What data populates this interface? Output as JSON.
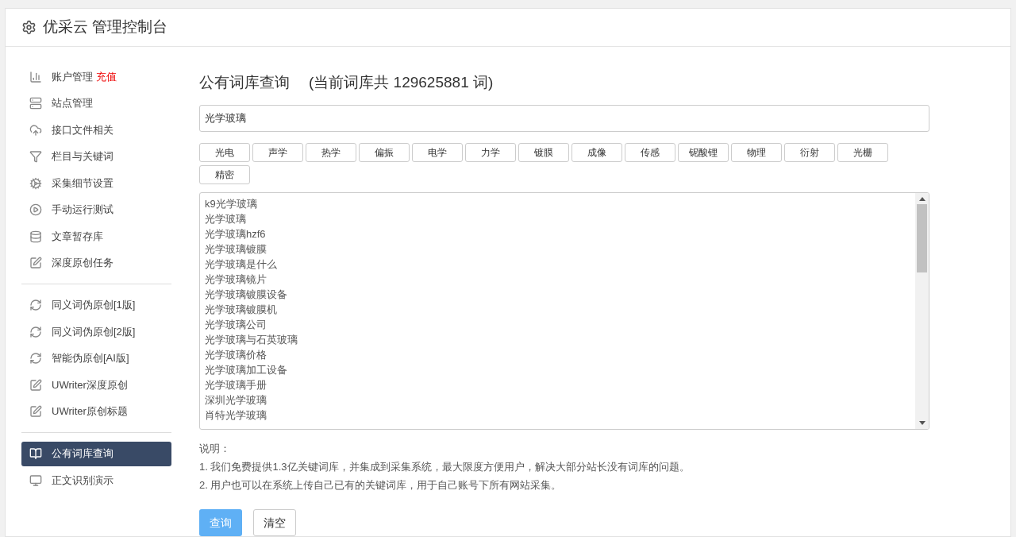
{
  "header": {
    "title": "优采云 管理控制台"
  },
  "sidebar": {
    "groups": [
      [
        {
          "label": "账户管理",
          "badge": "充值",
          "selected": false
        },
        {
          "label": "站点管理",
          "selected": false
        },
        {
          "label": "接口文件相关",
          "selected": false
        },
        {
          "label": "栏目与关键词",
          "selected": false
        },
        {
          "label": "采集细节设置",
          "selected": false
        },
        {
          "label": "手动运行测试",
          "selected": false
        },
        {
          "label": "文章暂存库",
          "selected": false
        },
        {
          "label": "深度原创任务",
          "selected": false
        }
      ],
      [
        {
          "label": "同义词伪原创[1版]",
          "selected": false
        },
        {
          "label": "同义词伪原创[2版]",
          "selected": false
        },
        {
          "label": "智能伪原创[AI版]",
          "selected": false
        },
        {
          "label": "UWriter深度原创",
          "selected": false
        },
        {
          "label": "UWriter原创标题",
          "selected": false
        }
      ],
      [
        {
          "label": "公有词库查询",
          "selected": true
        },
        {
          "label": "正文识别演示",
          "selected": false
        }
      ]
    ]
  },
  "main": {
    "title": "公有词库查询",
    "subtitle": "(当前词库共 129625881 词)",
    "search": {
      "value": "光学玻璃"
    },
    "tags": [
      "光电",
      "声学",
      "热学",
      "偏振",
      "电学",
      "力学",
      "镀膜",
      "成像",
      "传感",
      "铌酸锂",
      "物理",
      "衍射",
      "光栅",
      "精密"
    ],
    "results": [
      "k9光学玻璃",
      "光学玻璃",
      "光学玻璃hzf6",
      "光学玻璃镀膜",
      "光学玻璃是什么",
      "光学玻璃镜片",
      "光学玻璃镀膜设备",
      "光学玻璃镀膜机",
      "光学玻璃公司",
      "光学玻璃与石英玻璃",
      "光学玻璃价格",
      "光学玻璃加工设备",
      "光学玻璃手册",
      "深圳光学玻璃",
      "肖特光学玻璃"
    ],
    "notes_title": "说明：",
    "notes": [
      "1. 我们免费提供1.3亿关键词库，并集成到采集系统，最大限度方便用户，解决大部分站长没有词库的问题。",
      "2. 用户也可以在系统上传自己已有的关键词库，用于自己账号下所有网站采集。"
    ],
    "buttons": [
      {
        "label": "查询",
        "kind": "primary"
      },
      {
        "label": "清空",
        "kind": "default"
      }
    ]
  }
}
